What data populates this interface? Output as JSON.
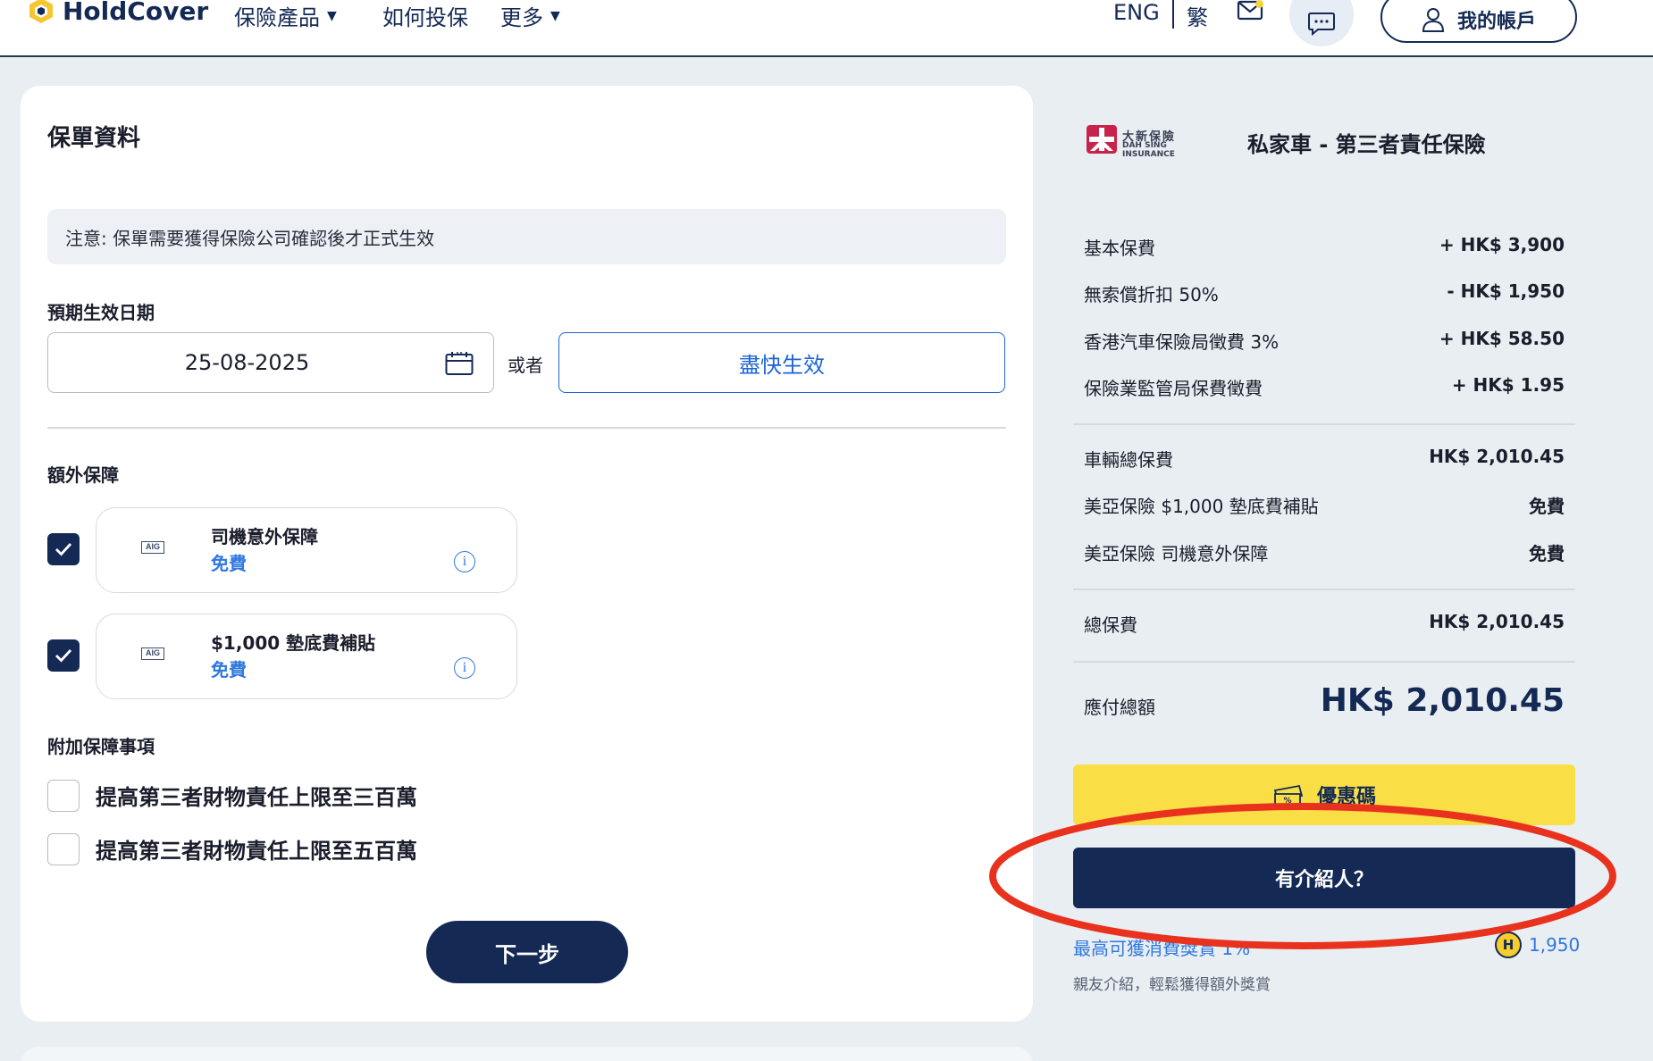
{
  "header": {
    "logo_text": "HoldCover",
    "nav": [
      {
        "label": "保險產品",
        "has_caret": true
      },
      {
        "label": "如何投保",
        "has_caret": false
      },
      {
        "label": "更多",
        "has_caret": true
      }
    ],
    "lang_eng": "ENG",
    "lang_trad": "繁",
    "account_label": "我的帳戶",
    "icons": [
      "mail-icon",
      "chat-icon",
      "user-icon"
    ]
  },
  "policy": {
    "title": "保單資料",
    "notice": "注意: 保單需要獲得保險公司確認後才正式生效",
    "start_date_label": "預期生效日期",
    "start_date_value": "25-08-2025",
    "or_text": "或者",
    "asap_label": "盡快生效",
    "extra_label": "額外保障",
    "addons": [
      {
        "provider": "AIG",
        "name": "司機意外保障",
        "price": "免費",
        "checked": true
      },
      {
        "provider": "AIG",
        "name": "$1,000 墊底費補貼",
        "price": "免費",
        "checked": true
      }
    ],
    "options_label": "附加保障事項",
    "options": [
      {
        "label": "提高第三者財物責任上限至三百萬",
        "checked": false
      },
      {
        "label": "提高第三者財物責任上限至五百萬",
        "checked": false
      }
    ],
    "next_label": "下一步"
  },
  "summary": {
    "insurer_cn": "大新保險",
    "insurer_en": "DAH SING INSURANCE",
    "product_title": "私家車 - 第三者責任保險",
    "rows_group1": [
      {
        "label": "基本保費",
        "value": "+ HK$ 3,900"
      },
      {
        "label": "無索償折扣 50%",
        "value": "- HK$ 1,950"
      },
      {
        "label": "香港汽車保險局徵費 3%",
        "value": "+ HK$ 58.50"
      },
      {
        "label": "保險業監管局保費徵費",
        "value": "+ HK$ 1.95"
      }
    ],
    "rows_group2": [
      {
        "label": "車輛總保費",
        "value": "HK$ 2,010.45"
      },
      {
        "label": "美亞保險 $1,000 墊底費補貼",
        "value": "免費"
      },
      {
        "label": "美亞保險 司機意外保障",
        "value": "免費"
      }
    ],
    "total": {
      "label": "總保費",
      "value": "HK$ 2,010.45"
    },
    "amount_due_label": "應付總額",
    "amount_due_value": "HK$ 2,010.45",
    "promo_label": "優惠碼",
    "referrer_label": "有介紹人？",
    "reward_text": "最高可獲消費獎賞 1%",
    "reward_coin": "H",
    "reward_points": "1,950",
    "friend_text": "親友介紹，輕鬆獲得額外獎賞"
  },
  "colors": {
    "navy": "#142a55",
    "accent_blue": "#2f78e0",
    "yellow": "#f9df45",
    "annotation_red": "#e8321e"
  }
}
